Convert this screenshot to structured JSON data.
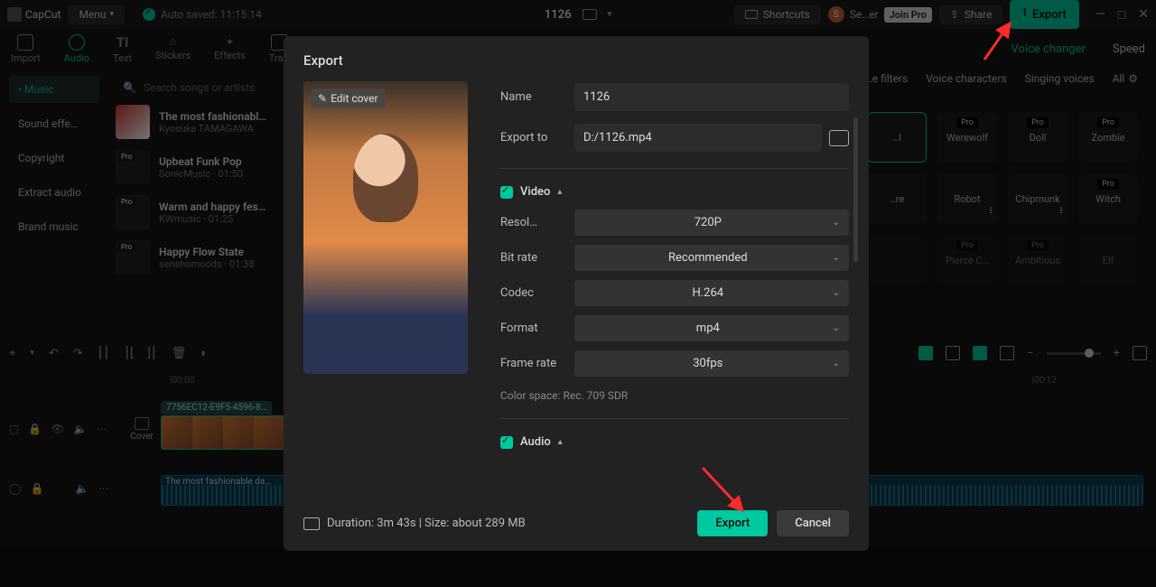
{
  "top": {
    "brand": "CapCut",
    "menu": "Menu",
    "autosaved": "Auto saved: 11:15:14",
    "title": "1126",
    "shortcuts": "Shortcuts",
    "user": "Se…er",
    "joinpro": "Join Pro",
    "share": "Share",
    "export": "Export"
  },
  "tabs": {
    "import": "Import",
    "audio": "Audio",
    "text": "Text",
    "stickers": "Stickers",
    "effects": "Effects",
    "transitions": "Tra…"
  },
  "tabs_right": {
    "voice": "Voice changer",
    "speed": "Speed"
  },
  "sidebar": {
    "items": [
      "Music",
      "Sound effe…",
      "Copyright",
      "Extract audio",
      "Brand music"
    ]
  },
  "search_ph": "Search songs or artists",
  "tracks": [
    {
      "title": "The most fashionabl…",
      "sub": "Kyosuke TAMAGAWA"
    },
    {
      "title": "Upbeat Funk Pop",
      "sub": "SonicMusic · 01:50"
    },
    {
      "title": "Warm and happy fes…",
      "sub": "KWmusic · 01:25"
    },
    {
      "title": "Happy Flow State",
      "sub": "senshomoods · 01:38"
    }
  ],
  "voice_tabs": {
    "filters": "…e filters",
    "chars": "Voice characters",
    "singing": "Singing voices",
    "all": "All"
  },
  "voices_row1": [
    "…l",
    "Werewolf",
    "Doll",
    "Zombie"
  ],
  "voices_row2": [
    "…re",
    "Robot",
    "Chipmunk",
    "Witch"
  ],
  "voices_row3": [
    "",
    "Pierce C…",
    "Ambitious",
    "Elf"
  ],
  "ruler": {
    "t0": "|00:00",
    "t1": "|00:12"
  },
  "clip_name": "7756EC12-E9F5-4596-8…",
  "cover_lbl": "Cover",
  "audio_clip": "The most fashionable da…",
  "modal": {
    "title": "Export",
    "edit_cover": "Edit cover",
    "name_lbl": "Name",
    "name_val": "1126",
    "export_lbl": "Export to",
    "export_val": "D:/1126.mp4",
    "video": "Video",
    "audio": "Audio",
    "res_lbl": "Resol…",
    "res_val": "720P",
    "bitrate_lbl": "Bit rate",
    "bitrate_val": "Recommended",
    "codec_lbl": "Codec",
    "codec_val": "H.264",
    "format_lbl": "Format",
    "format_val": "mp4",
    "fps_lbl": "Frame rate",
    "fps_val": "30fps",
    "colorspace": "Color space: Rec. 709 SDR",
    "duration": "Duration: 3m 43s | Size: about 289 MB",
    "export_btn": "Export",
    "cancel": "Cancel"
  }
}
